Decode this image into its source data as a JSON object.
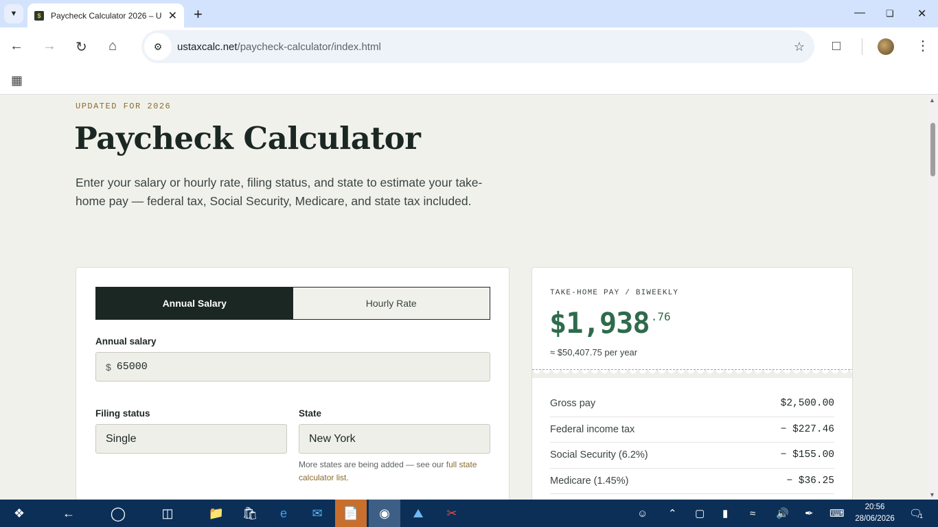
{
  "browser": {
    "tab_title": "Paycheck Calculator 2026 – U",
    "favicon_text": "$",
    "url_host": "ustaxcalc.net",
    "url_path": "/paycheck-calculator/index.html"
  },
  "page": {
    "eyebrow": "UPDATED FOR 2026",
    "title": "Paycheck Calculator",
    "lead": "Enter your salary or hourly rate, filing status, and state to estimate your take-home pay — federal tax, Social Security, Medicare, and state tax included."
  },
  "form": {
    "toggle_annual": "Annual Salary",
    "toggle_hourly": "Hourly Rate",
    "salary_label": "Annual salary",
    "currency_symbol": "$",
    "salary_value": "65000",
    "filing_label": "Filing status",
    "filing_value": "Single",
    "state_label": "State",
    "state_value": "New York",
    "note_text": "More states are being added — see our ",
    "note_link": "full state calculator list",
    "note_end": "."
  },
  "result": {
    "eyebrow": "TAKE-HOME PAY / BIWEEKLY",
    "amount_main": "$1,938",
    "amount_cents": ".76",
    "annual": "≈ $50,407.75 per year",
    "rows": [
      {
        "label": "Gross pay",
        "value": "$2,500.00"
      },
      {
        "label": "Federal income tax",
        "value": "− $227.46"
      },
      {
        "label": "Social Security (6.2%)",
        "value": "− $155.00"
      },
      {
        "label": "Medicare (1.45%)",
        "value": "− $36.25"
      }
    ]
  },
  "taskbar": {
    "time": "20:56",
    "date": "28/06/2026",
    "notification_count": "1"
  },
  "colors": {
    "accent_green": "#2e6b4c",
    "dark": "#1b2722",
    "gold": "#8a6a2f",
    "taskbar": "#0c2f57"
  }
}
